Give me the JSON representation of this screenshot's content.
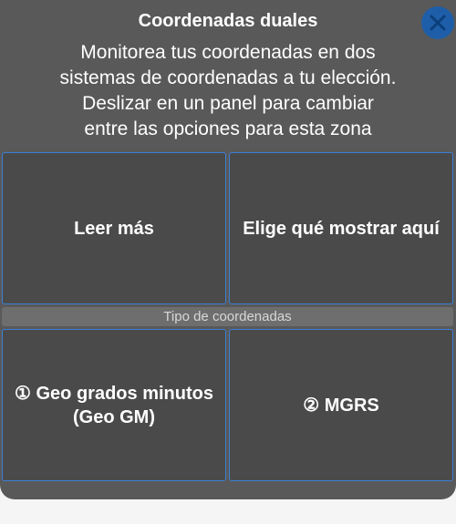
{
  "header": {
    "title": "Coordenadas duales",
    "close_icon": "close-icon"
  },
  "description": {
    "lines": [
      "Monitorea tus coordenadas en dos",
      "sistemas de coordenadas a tu elección.",
      "Deslizar en un panel para cambiar",
      "entre las opciones para esta zona"
    ]
  },
  "panels": {
    "read_more": "Leer más",
    "choose": "Elige qué mostrar aquí",
    "type_label": "Tipo de coordenadas",
    "option1_line1": "① Geo grados minutos",
    "option1_line2": "(Geo GM)",
    "option2": "② MGRS"
  },
  "colors": {
    "accent": "#3c7fd6",
    "close_button": "#1e5ea8",
    "sheet_bg": "#595959"
  }
}
